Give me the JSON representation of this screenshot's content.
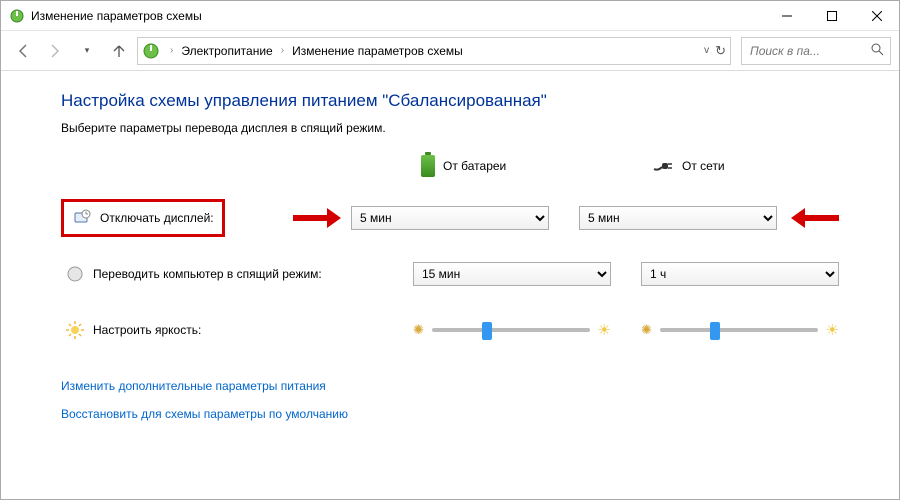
{
  "titlebar": {
    "title": "Изменение параметров схемы"
  },
  "breadcrumb": {
    "item1": "Электропитание",
    "item2": "Изменение параметров схемы"
  },
  "search": {
    "placeholder": "Поиск в па..."
  },
  "heading": "Настройка схемы управления питанием \"Сбалансированная\"",
  "subheading": "Выберите параметры перевода дисплея в спящий режим.",
  "columns": {
    "battery": "От батареи",
    "plugged": "От сети"
  },
  "rows": {
    "display": {
      "label": "Отключать дисплей:",
      "battery_value": "5 мин",
      "plugged_value": "5 мин"
    },
    "sleep": {
      "label": "Переводить компьютер в спящий режим:",
      "battery_value": "15 мин",
      "plugged_value": "1 ч"
    },
    "brightness": {
      "label": "Настроить яркость:"
    }
  },
  "links": {
    "advanced": "Изменить дополнительные параметры питания",
    "restore": "Восстановить для схемы параметры по умолчанию"
  }
}
